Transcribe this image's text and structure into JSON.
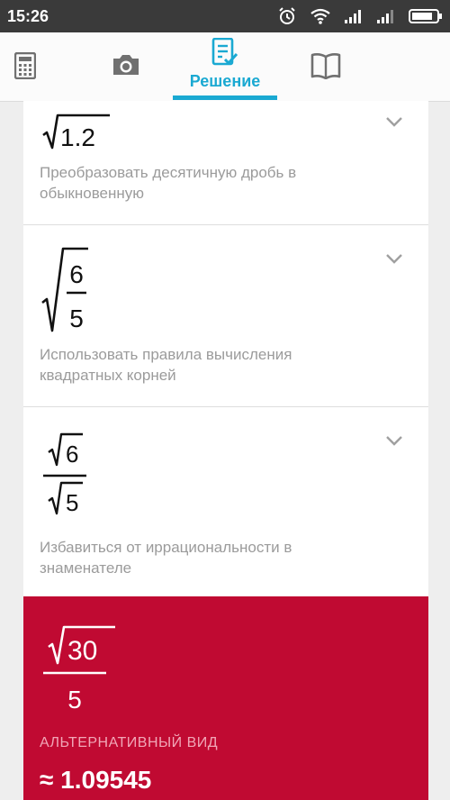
{
  "status_bar": {
    "time": "15:26",
    "icons": [
      "alarm-icon",
      "wifi-icon",
      "signal-icon",
      "signal-icon",
      "battery-icon"
    ]
  },
  "tabs": [
    {
      "name": "calculator",
      "icon": "calculator-icon",
      "label": ""
    },
    {
      "name": "camera",
      "icon": "camera-icon",
      "label": ""
    },
    {
      "name": "solution",
      "icon": "solution-icon",
      "label": "Решение",
      "active": true
    },
    {
      "name": "book",
      "icon": "book-icon",
      "label": ""
    }
  ],
  "steps": [
    {
      "expression": {
        "radicand": "1.2"
      },
      "hint": "Преобразовать десятичную дробь в обыкновенную"
    },
    {
      "expression": {
        "numerator": "6",
        "denominator": "5"
      },
      "hint": "Использовать правила вычисления квадратных корней"
    },
    {
      "expression": {
        "numerator": "6",
        "denominator": "5"
      },
      "hint": "Избавиться от иррациональности в знаменателе"
    }
  ],
  "result": {
    "numerator": "30",
    "denominator": "5",
    "alt_label": "АЛЬТЕРНАТИВНЫЙ ВИД",
    "approx": "≈ 1.09545"
  },
  "colors": {
    "accent": "#1aa9d2",
    "result_background": "#c00a32",
    "status_bar": "#3a3a3a"
  }
}
